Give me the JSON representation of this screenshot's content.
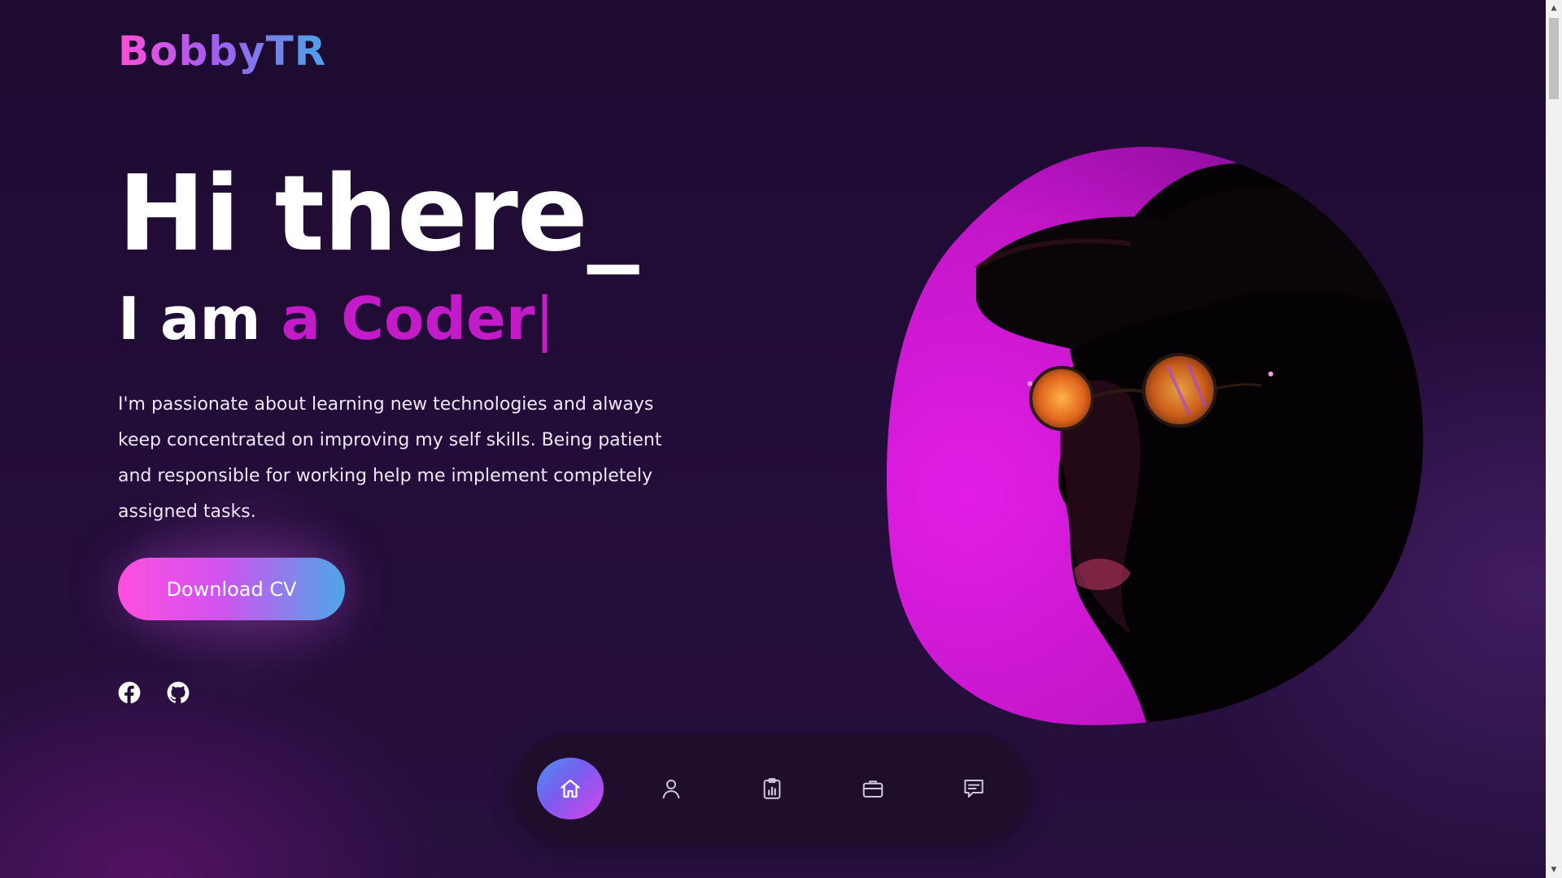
{
  "brand": {
    "name": "BobbyTR"
  },
  "hero": {
    "greeting": "Hi there_",
    "intro_prefix": "I am ",
    "intro_role": "a Coder",
    "intro_caret": "|",
    "bio": "I'm passionate about learning new technologies and always keep concentrated on improving my self skills. Being patient and responsible for working help me implement completely assigned tasks.",
    "cta_label": "Download CV"
  },
  "social": [
    {
      "name": "facebook",
      "icon": "facebook-icon"
    },
    {
      "name": "github",
      "icon": "github-icon"
    }
  ],
  "dock": {
    "items": [
      {
        "name": "home",
        "icon": "home-icon",
        "active": true
      },
      {
        "name": "about",
        "icon": "user-icon",
        "active": false
      },
      {
        "name": "skills",
        "icon": "clipboard-chart-icon",
        "active": false
      },
      {
        "name": "portfolio",
        "icon": "briefcase-icon",
        "active": false
      },
      {
        "name": "contact",
        "icon": "message-icon",
        "active": false
      }
    ]
  },
  "colors": {
    "background": "#1d0b31",
    "accent_magenta": "#c41bc9",
    "gradient_pink": "#ff4fe0",
    "gradient_blue": "#4ea6e6",
    "dock_bg": "#1e0d2b"
  }
}
